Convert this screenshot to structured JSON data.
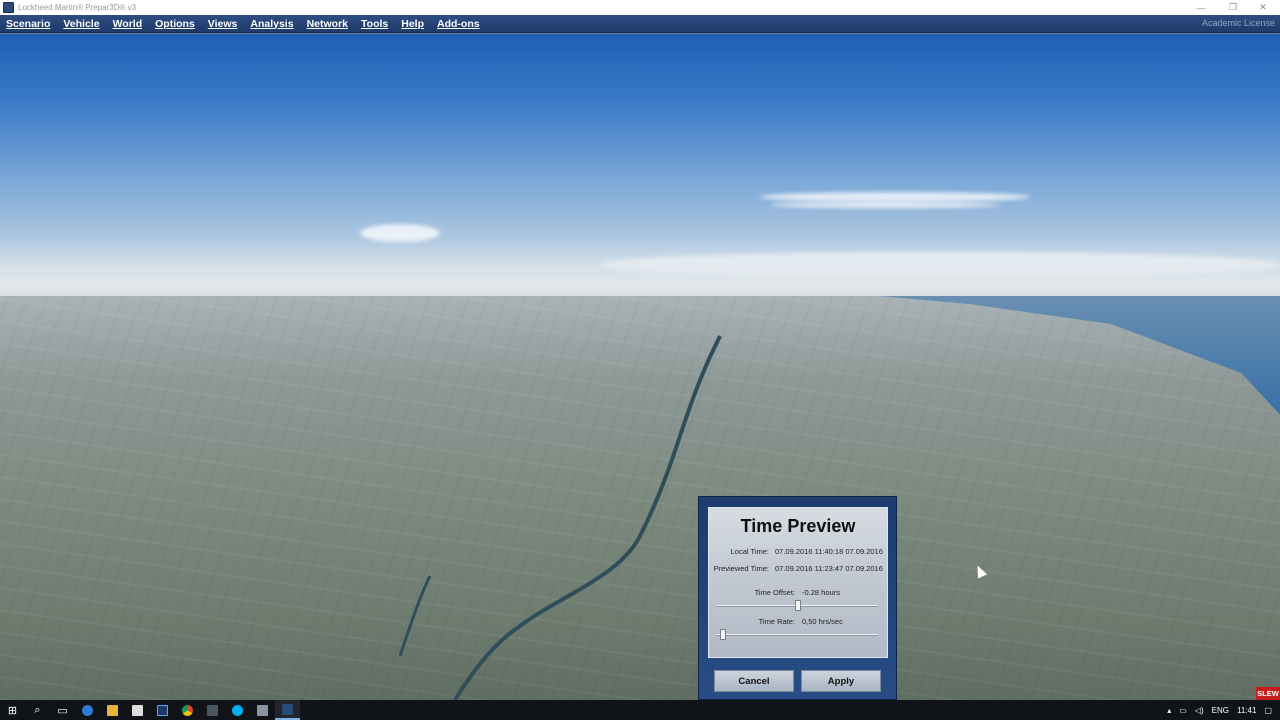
{
  "window": {
    "title": "Lockheed Martin® Prepar3D® v3",
    "minimize": "—",
    "restore": "❐",
    "close": "✕",
    "license": "Academic License"
  },
  "menu": [
    {
      "label": "Scenario"
    },
    {
      "label": "Vehicle"
    },
    {
      "label": "World"
    },
    {
      "label": "Options"
    },
    {
      "label": "Views"
    },
    {
      "label": "Analysis"
    },
    {
      "label": "Network"
    },
    {
      "label": "Tools"
    },
    {
      "label": "Help"
    },
    {
      "label": "Add-ons"
    }
  ],
  "dialog": {
    "title": "Time Preview",
    "local_time_label": "Local Time:",
    "local_time_value": "07.09.2016 11:40:18   07.09.2016",
    "previewed_time_label": "Previewed Time:",
    "previewed_time_value": "07.09.2016 11:23:47   07.09.2016",
    "time_offset_label": "Time Offset:",
    "time_offset_value": "-0.28 hours",
    "time_offset_slider": 0.5,
    "time_rate_label": "Time Rate:",
    "time_rate_value": "0,50 hrs/sec",
    "time_rate_slider": 0.04,
    "cancel_label": "Cancel",
    "apply_label": "Apply"
  },
  "status": {
    "slew": "SLEW"
  },
  "taskbar": {
    "icons": [
      "windows-start-icon",
      "search-icon",
      "task-view-icon",
      "edge-icon",
      "file-explorer-icon",
      "store-icon",
      "photoshop-icon",
      "chrome-icon",
      "app-icon",
      "skype-icon",
      "app-icon-2",
      "prepar3d-icon"
    ],
    "language": "ENG",
    "clock": "11:41"
  },
  "colors": {
    "menubar": "#1f3a6b",
    "dialog_frame": "#284c85",
    "slew_badge": "#c41d1d"
  }
}
